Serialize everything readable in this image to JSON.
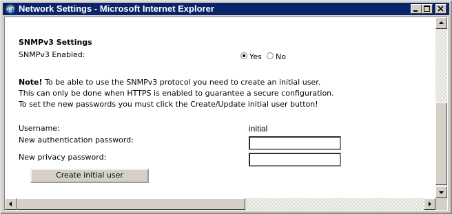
{
  "window": {
    "title": "Network Settings - Microsoft Internet Explorer"
  },
  "section": {
    "heading": "SNMPv3 Settings"
  },
  "snmp": {
    "enabled_label": "SNMPv3 Enabled:",
    "yes_label": "Yes",
    "no_label": "No",
    "selected": "Yes"
  },
  "note": {
    "prefix": "Note!",
    "line1": " To be able to use the SNMPv3 protocol you need to create an initial user.",
    "line2": "This can only be done when HTTPS is enabled to guarantee a secure configuration.",
    "line3": "To set the new passwords you must click the Create/Update initial user button!"
  },
  "form": {
    "username_label": "Username:",
    "username_value": "initial",
    "auth_label": "New authentication password:",
    "privacy_label": "New privacy password:",
    "auth_value": "",
    "privacy_value": "",
    "create_button": "Create initial user"
  },
  "colors": {
    "titlebar": "#0a246a",
    "chrome": "#d4d0c8"
  }
}
